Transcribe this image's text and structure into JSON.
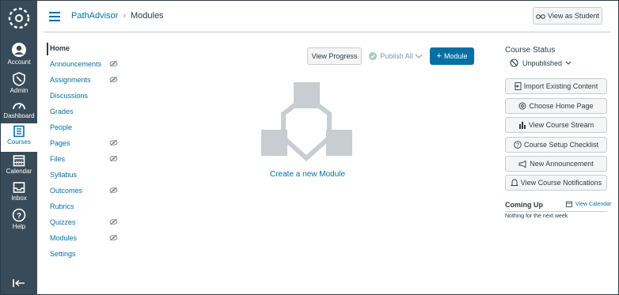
{
  "global_nav": {
    "items": [
      {
        "label": "Account",
        "icon": "account-icon"
      },
      {
        "label": "Admin",
        "icon": "admin-shield-icon"
      },
      {
        "label": "Dashboard",
        "icon": "dashboard-icon"
      },
      {
        "label": "Courses",
        "icon": "courses-icon",
        "active": true
      },
      {
        "label": "Calendar",
        "icon": "calendar-icon"
      },
      {
        "label": "Inbox",
        "icon": "inbox-icon"
      },
      {
        "label": "Help",
        "icon": "help-icon"
      }
    ],
    "colors": {
      "background": "#394b58",
      "active_bg": "#ffffff",
      "active_fg": "#0770a3"
    }
  },
  "header": {
    "breadcrumb_course": "PathAdvisor",
    "breadcrumb_separator": "›",
    "breadcrumb_current": "Modules",
    "view_as_student": "View as Student"
  },
  "course_nav": {
    "items": [
      {
        "label": "Home",
        "hidden": false
      },
      {
        "label": "Announcements",
        "hidden": true
      },
      {
        "label": "Assignments",
        "hidden": true
      },
      {
        "label": "Discussions",
        "hidden": false
      },
      {
        "label": "Grades",
        "hidden": false
      },
      {
        "label": "People",
        "hidden": false
      },
      {
        "label": "Pages",
        "hidden": true
      },
      {
        "label": "Files",
        "hidden": true
      },
      {
        "label": "Syllabus",
        "hidden": false
      },
      {
        "label": "Outcomes",
        "hidden": true
      },
      {
        "label": "Rubrics",
        "hidden": false
      },
      {
        "label": "Quizzes",
        "hidden": true
      },
      {
        "label": "Modules",
        "hidden": true
      },
      {
        "label": "Settings",
        "hidden": false
      }
    ]
  },
  "toolbar": {
    "view_progress": "View Progress",
    "publish_all": "Publish All",
    "add_module": "Module"
  },
  "main": {
    "create_module_link": "Create a new Module"
  },
  "sidebar": {
    "status_title": "Course Status",
    "status_value": "Unpublished",
    "actions": [
      {
        "label": "Import Existing Content",
        "icon": "import-icon"
      },
      {
        "label": "Choose Home Page",
        "icon": "target-icon"
      },
      {
        "label": "View Course Stream",
        "icon": "bar-chart-icon"
      },
      {
        "label": "Course Setup Checklist",
        "icon": "question-icon"
      },
      {
        "label": "New Announcement",
        "icon": "megaphone-icon"
      },
      {
        "label": "View Course Notifications",
        "icon": "bell-icon"
      }
    ],
    "coming_up_title": "Coming Up",
    "view_calendar": "View Calendar",
    "coming_up_empty": "Nothing for the next week"
  },
  "colors": {
    "brand": "#0770a3",
    "text": "#2d3b45",
    "border": "#c7cdd1",
    "success": "#0b874b"
  }
}
